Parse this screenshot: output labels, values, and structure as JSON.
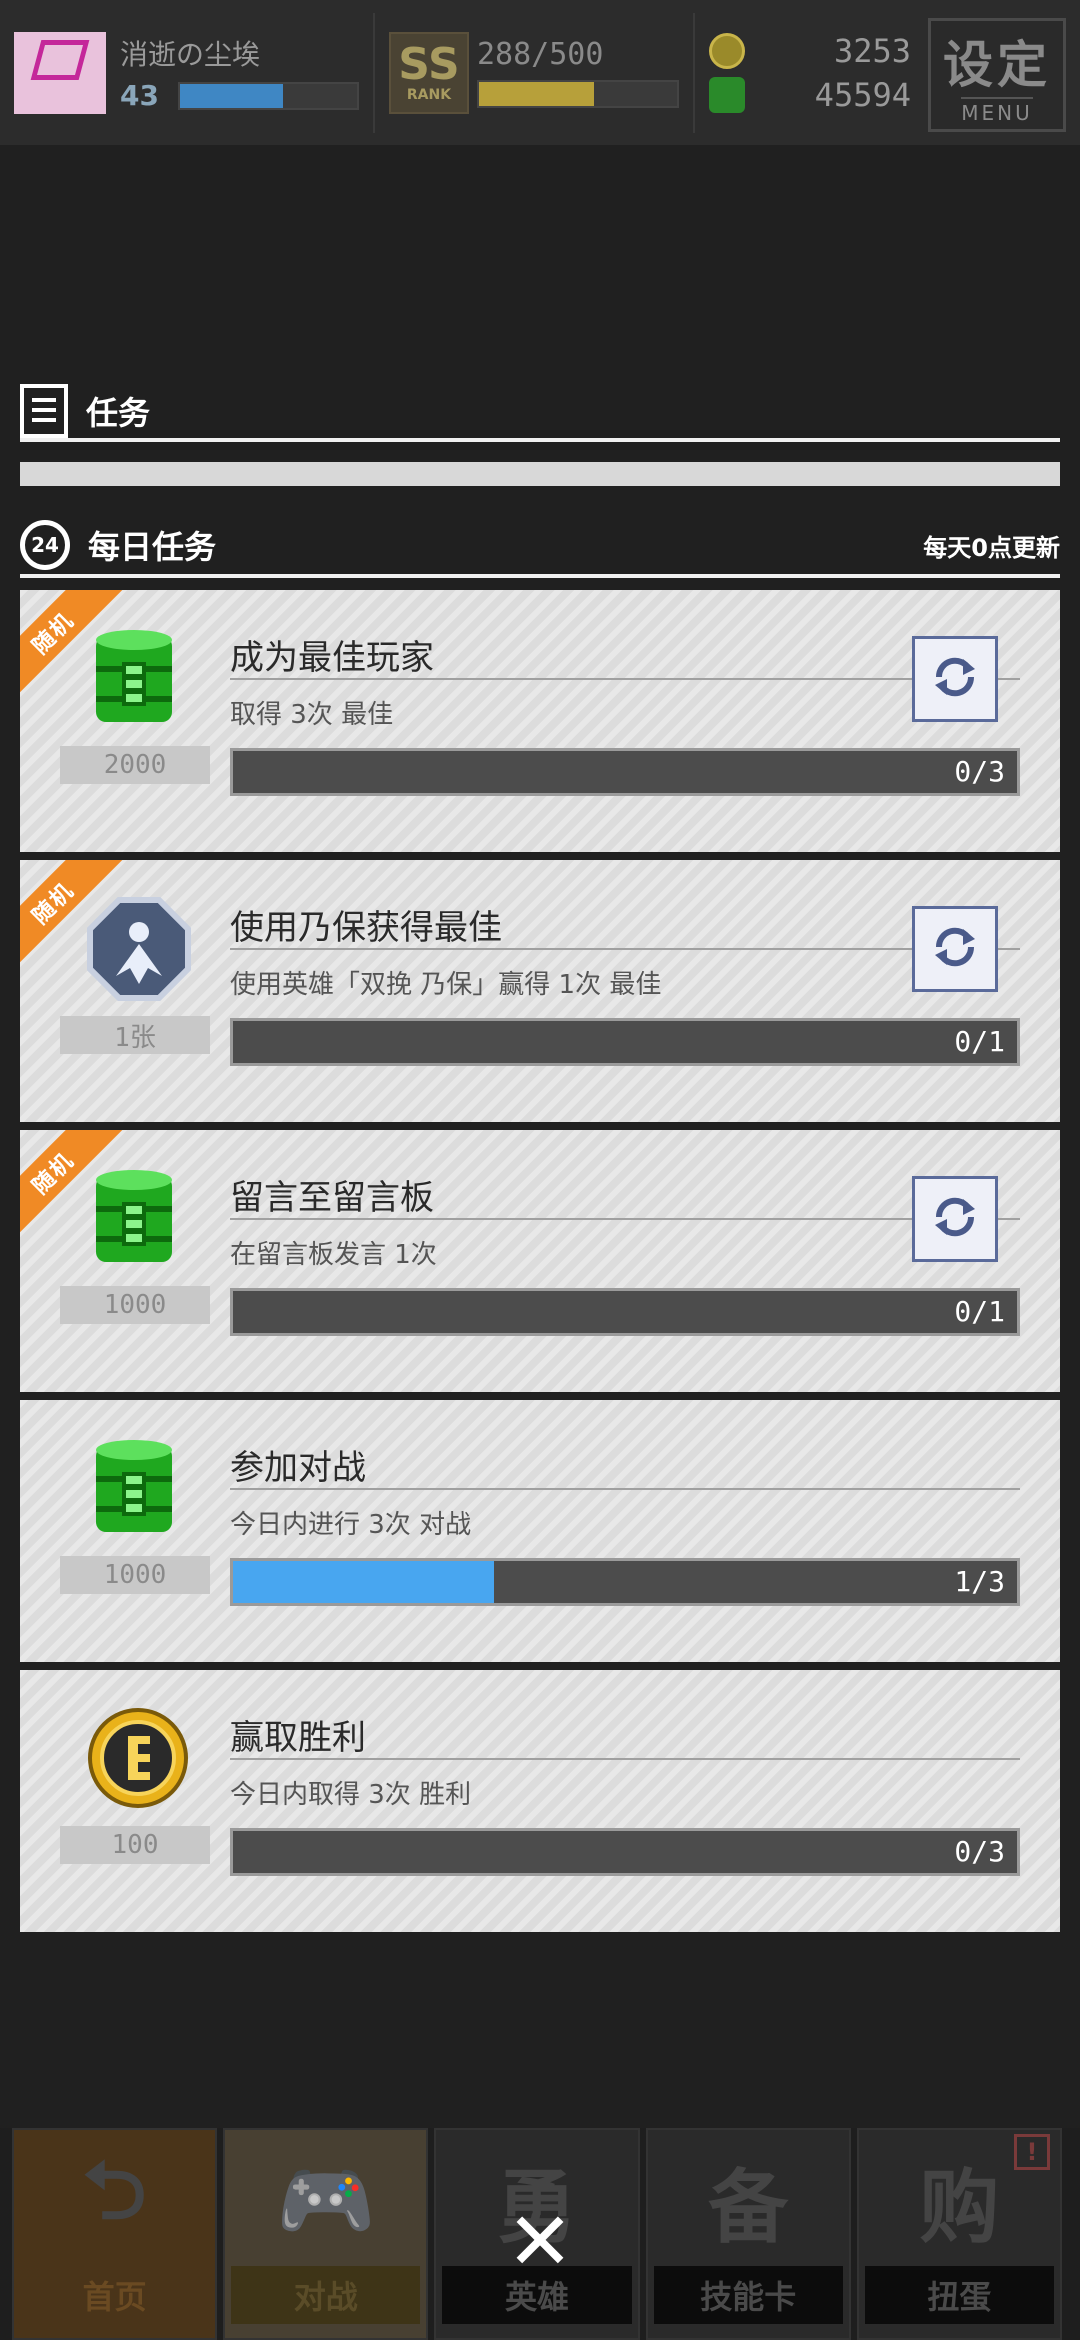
{
  "topbar": {
    "player_name": "消逝の尘埃",
    "level": "43",
    "level_progress": 0.58,
    "rank_score": "288/500",
    "rank_progress": 0.58,
    "currency_1": "3253",
    "currency_2": "45594",
    "menu_cn": "设定",
    "menu_en": "MENU"
  },
  "section": {
    "title": "任务"
  },
  "daily": {
    "title": "每日任务",
    "note": "每天0点更新",
    "clock_label": "24"
  },
  "tasks": [
    {
      "tag": "随机",
      "title": "成为最佳玩家",
      "desc": "取得  3次  最佳",
      "reward_qty": "2000",
      "reward_icon": "green-canister-icon",
      "progress_text": "0/3",
      "progress": 0,
      "refreshable": true
    },
    {
      "tag": "随机",
      "title": "使用乃保获得最佳",
      "desc": "使用英雄「双挽  乃保」赢得  1次  最佳",
      "reward_qty": "1张",
      "reward_icon": "hero-card-icon",
      "progress_text": "0/1",
      "progress": 0,
      "refreshable": true
    },
    {
      "tag": "随机",
      "title": "留言至留言板",
      "desc": "在留言板发言  1次",
      "reward_qty": "1000",
      "reward_icon": "green-canister-icon",
      "progress_text": "0/1",
      "progress": 0,
      "refreshable": true
    },
    {
      "tag": "",
      "title": "参加对战",
      "desc": "今日内进行  3次  对战",
      "reward_qty": "1000",
      "reward_icon": "green-canister-icon",
      "progress_text": "1/3",
      "progress": 0.333,
      "refreshable": false
    },
    {
      "tag": "",
      "title": "赢取胜利",
      "desc": "今日内取得  3次  胜利",
      "reward_qty": "100",
      "reward_icon": "gold-coin-icon",
      "progress_text": "0/3",
      "progress": 0,
      "refreshable": false
    }
  ],
  "nav": [
    {
      "label": "首页",
      "icon": "home-icon"
    },
    {
      "label": "对战",
      "icon": "gamepad-icon"
    },
    {
      "label": "英雄",
      "icon": "hero-icon"
    },
    {
      "label": "技能卡",
      "icon": "skill-card-icon"
    },
    {
      "label": "扭蛋",
      "icon": "gacha-icon"
    }
  ],
  "colors": {
    "accent_blue": "#48a6f0",
    "ribbon_orange": "#f08a25",
    "green": "#2fcf2f",
    "gold": "#e9b21a"
  }
}
